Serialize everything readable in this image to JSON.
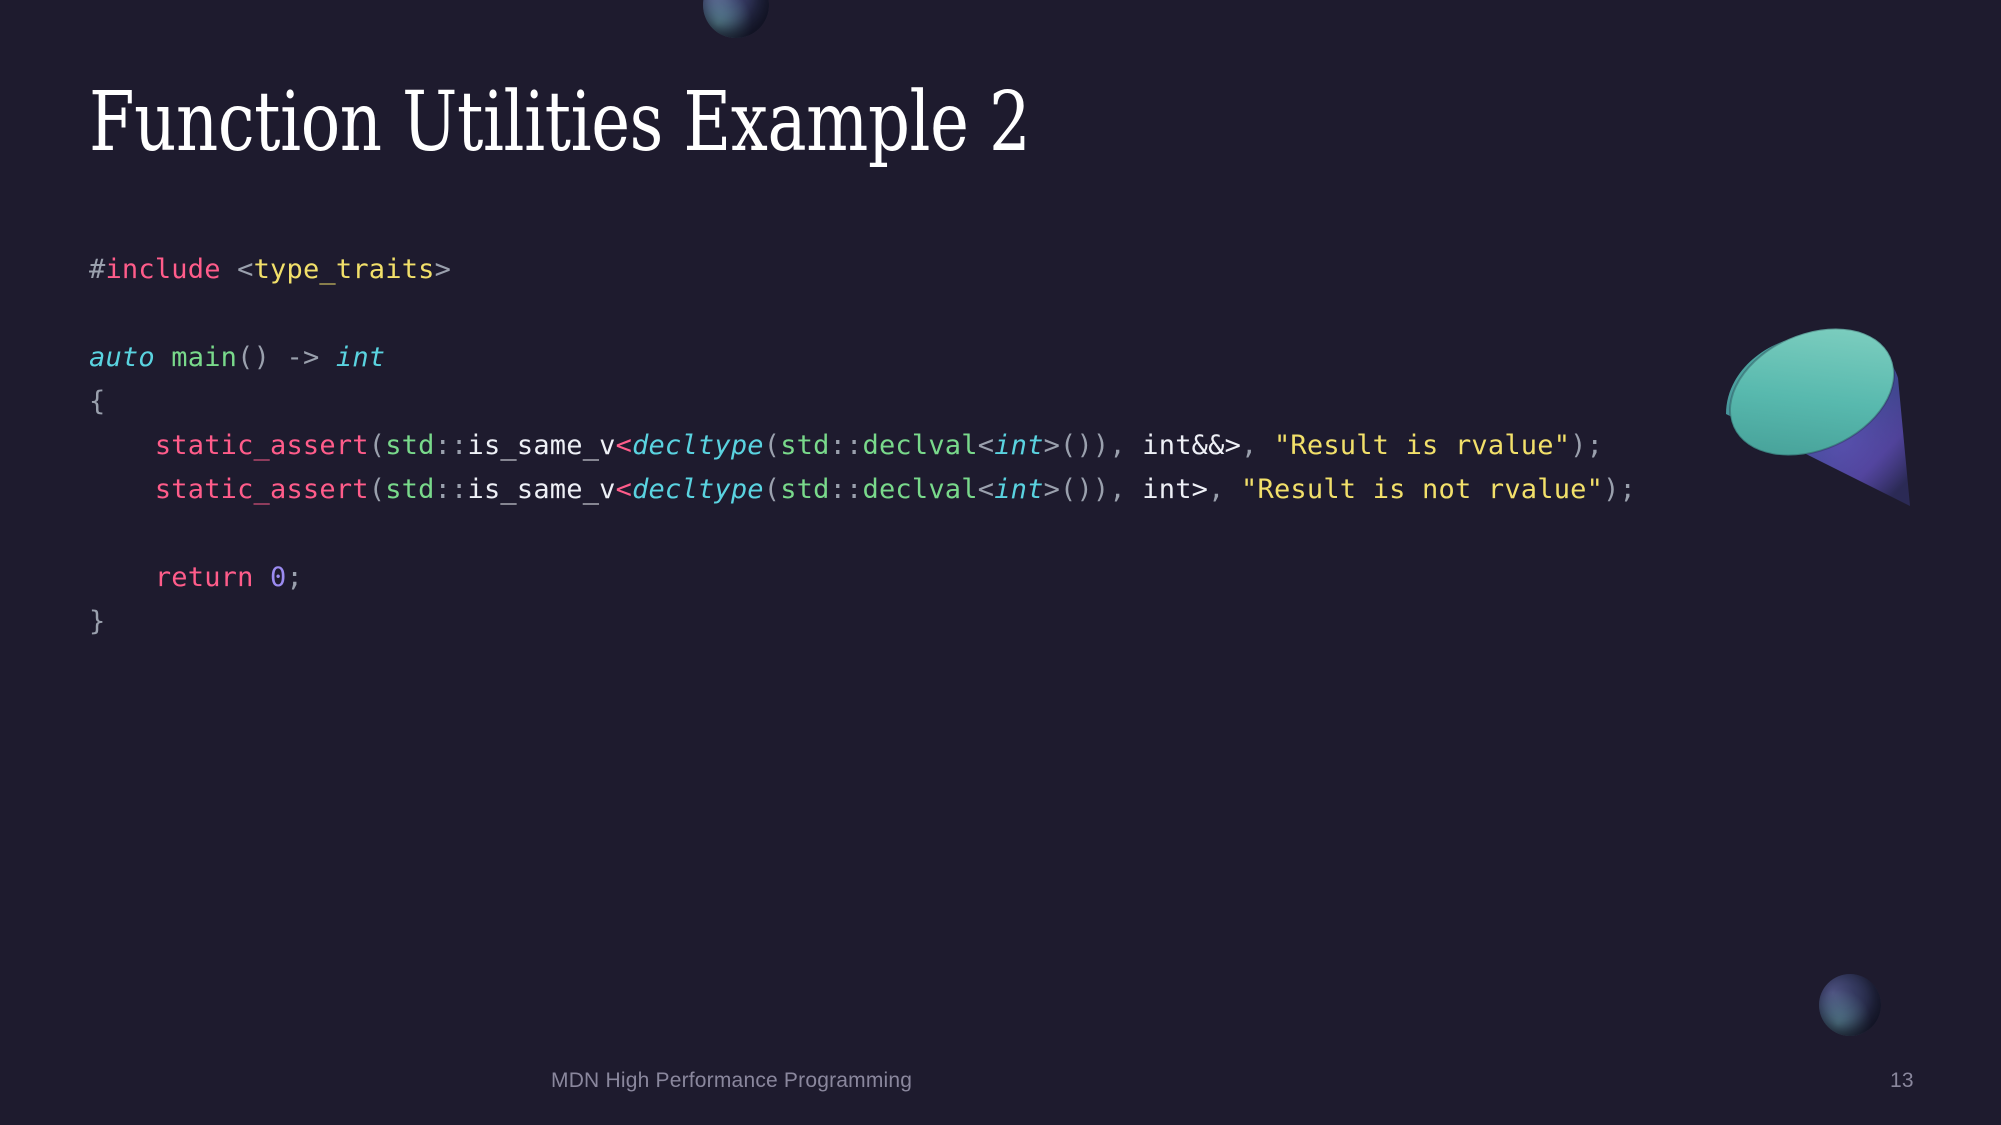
{
  "slide": {
    "background_color": "#1e1b2e",
    "title": "Function Utilities Example 2",
    "title_color": "#ffffff"
  },
  "footer": {
    "text": "MDN High Performance Programming",
    "page_number": "13",
    "color": "#8a879d"
  },
  "decorations": [
    {
      "name": "sphere-top",
      "shape": "sphere",
      "colors": [
        "#5c5f91",
        "#7dc8c3",
        "#1f2338"
      ]
    },
    {
      "name": "sphere-bottom",
      "shape": "sphere",
      "colors": [
        "#4e5281",
        "#78bebe",
        "#1e2237"
      ]
    },
    {
      "name": "cone",
      "shape": "cone",
      "colors": [
        "#4aa39b",
        "#3f7f97",
        "#4a3f8f",
        "#2a2a52"
      ]
    }
  ],
  "code": {
    "language": "cpp",
    "colors": {
      "punctuation": "#9aa0ad",
      "keyword": "#ff5c8a",
      "string": "#f2e06a",
      "type": "#5ad3e0",
      "function": "#79d98b",
      "plain": "#eef0f6",
      "number": "#9b8bf0"
    },
    "lines": [
      {
        "tokens": [
          {
            "t": "#",
            "c": "punc"
          },
          {
            "t": "include",
            "c": "kw"
          },
          {
            "t": " <",
            "c": "punc"
          },
          {
            "t": "type_traits",
            "c": "str"
          },
          {
            "t": ">",
            "c": "punc"
          }
        ]
      },
      {
        "tokens": []
      },
      {
        "tokens": [
          {
            "t": "auto",
            "c": "type"
          },
          {
            "t": " ",
            "c": "punc"
          },
          {
            "t": "main",
            "c": "fn"
          },
          {
            "t": "() -> ",
            "c": "punc"
          },
          {
            "t": "int",
            "c": "type"
          }
        ]
      },
      {
        "tokens": [
          {
            "t": "{",
            "c": "punc"
          }
        ]
      },
      {
        "tokens": [
          {
            "t": "    ",
            "c": "punc"
          },
          {
            "t": "static_assert",
            "c": "kw"
          },
          {
            "t": "(",
            "c": "punc"
          },
          {
            "t": "std",
            "c": "fn"
          },
          {
            "t": "::",
            "c": "punc"
          },
          {
            "t": "is_same_v",
            "c": "plain"
          },
          {
            "t": "<",
            "c": "op"
          },
          {
            "t": "decltype",
            "c": "type"
          },
          {
            "t": "(",
            "c": "punc"
          },
          {
            "t": "std",
            "c": "fn"
          },
          {
            "t": "::",
            "c": "punc"
          },
          {
            "t": "declval",
            "c": "fn"
          },
          {
            "t": "<",
            "c": "punc"
          },
          {
            "t": "int",
            "c": "type"
          },
          {
            "t": ">()), ",
            "c": "punc"
          },
          {
            "t": "int&&>",
            "c": "plain"
          },
          {
            "t": ", ",
            "c": "punc"
          },
          {
            "t": "\"Result is rvalue\"",
            "c": "str"
          },
          {
            "t": ");",
            "c": "punc"
          }
        ]
      },
      {
        "tokens": [
          {
            "t": "    ",
            "c": "punc"
          },
          {
            "t": "static_assert",
            "c": "kw"
          },
          {
            "t": "(",
            "c": "punc"
          },
          {
            "t": "std",
            "c": "fn"
          },
          {
            "t": "::",
            "c": "punc"
          },
          {
            "t": "is_same_v",
            "c": "plain"
          },
          {
            "t": "<",
            "c": "op"
          },
          {
            "t": "decltype",
            "c": "type"
          },
          {
            "t": "(",
            "c": "punc"
          },
          {
            "t": "std",
            "c": "fn"
          },
          {
            "t": "::",
            "c": "punc"
          },
          {
            "t": "declval",
            "c": "fn"
          },
          {
            "t": "<",
            "c": "punc"
          },
          {
            "t": "int",
            "c": "type"
          },
          {
            "t": ">()), ",
            "c": "punc"
          },
          {
            "t": "int>",
            "c": "plain"
          },
          {
            "t": ", ",
            "c": "punc"
          },
          {
            "t": "\"Result is not rvalue\"",
            "c": "str"
          },
          {
            "t": ");",
            "c": "punc"
          }
        ]
      },
      {
        "tokens": []
      },
      {
        "tokens": [
          {
            "t": "    ",
            "c": "punc"
          },
          {
            "t": "return",
            "c": "kw"
          },
          {
            "t": " ",
            "c": "punc"
          },
          {
            "t": "0",
            "c": "num"
          },
          {
            "t": ";",
            "c": "punc"
          }
        ]
      },
      {
        "tokens": [
          {
            "t": "}",
            "c": "punc"
          }
        ]
      }
    ]
  }
}
